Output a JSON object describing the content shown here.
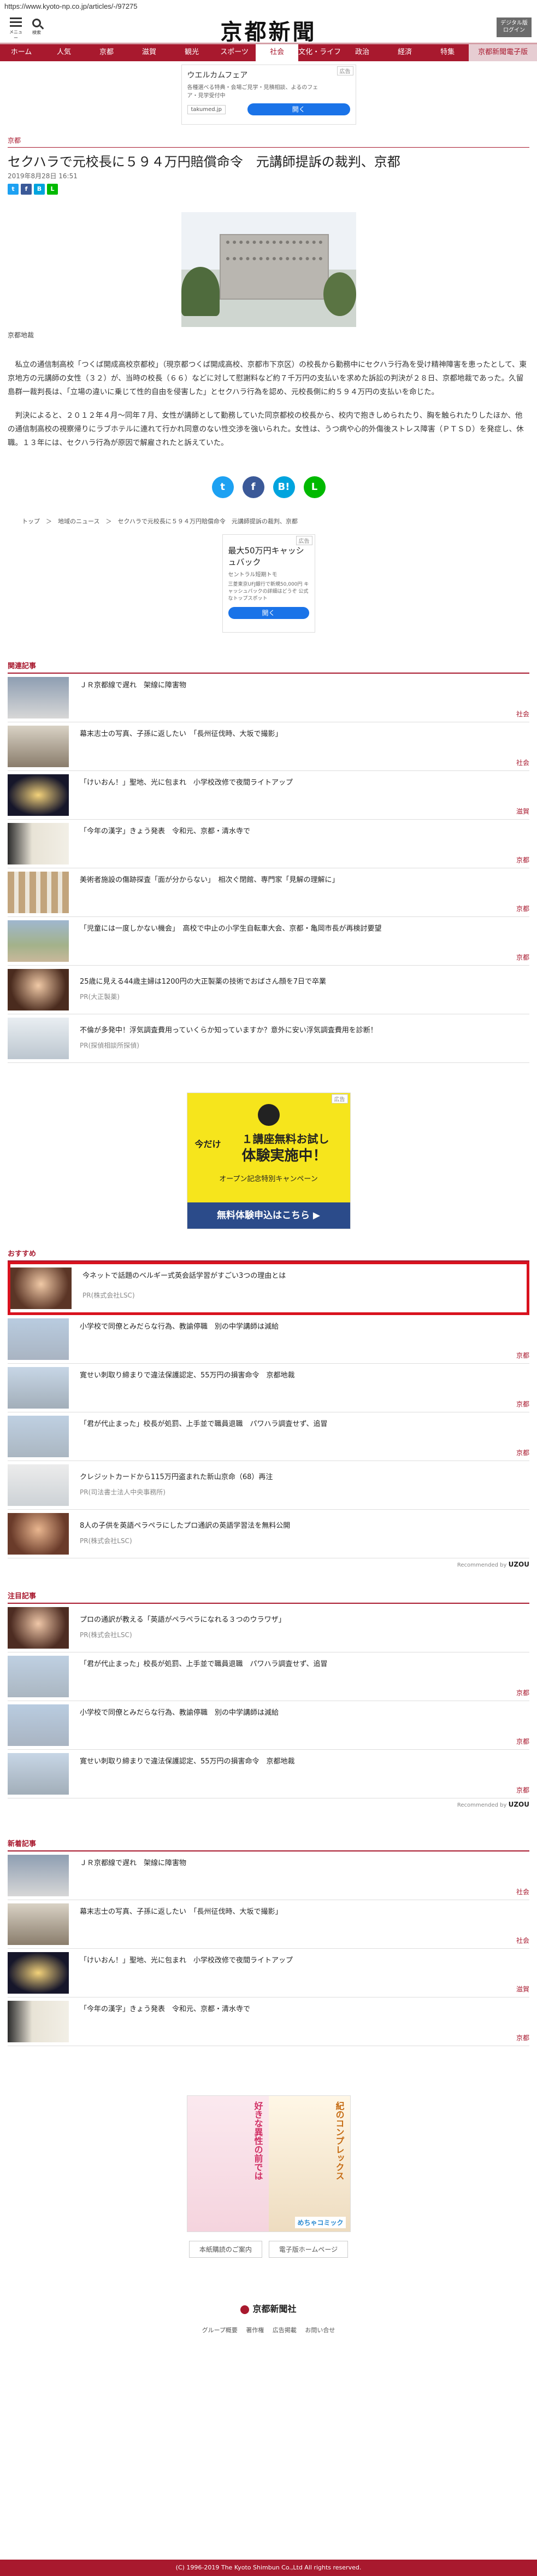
{
  "url": "https://www.kyoto-np.co.jp/articles/-/97275",
  "header": {
    "menu_label": "メニュー",
    "search_label": "検索",
    "logo": "京都新聞",
    "digital_line1": "デジタル版",
    "digital_line2": "ログイン"
  },
  "nav": [
    "ホーム",
    "人気",
    "京都",
    "滋賀",
    "観光",
    "スポーツ",
    "社会",
    "文化・ライフ",
    "政治",
    "経済",
    "特集",
    "京都新聞電子版"
  ],
  "top_ad": {
    "tag": "広告",
    "title": "ウエルカムフェア",
    "text": "各種選べる特典・会場ご見学・見積相談、よるのフェア・見学受付中",
    "domain": "takumed.jp",
    "button": "開く"
  },
  "article": {
    "section": "京都",
    "headline": "セクハラで元校長に５９４万円賠償命令　元講師提訴の裁判、京都",
    "date": "2019年8月28日 16:51",
    "caption": "京都地裁",
    "paragraphs": [
      "私立の通信制高校「つくば開成高校京都校」（現京都つくば開成高校、京都市下京区）の校長から勤務中にセクハラ行為を受け精神障害を患ったとして、東京地方の元講師の女性（３２）が、当時の校長（６６）などに対して慰謝料など約７千万円の支払いを求めた訴訟の判決が２８日、京都地裁であった。久留島群一裁判長は、「立場の違いに乗じて性的自由を侵害した」とセクハラ行為を認め、元校長側に約５９４万円の支払いを命じた。",
      "判決によると、２０１２年４月〜同年７月、女性が講師として勤務していた同京都校の校長から、校内で抱きしめられたり、胸を触られたりしたほか、他の通信制高校の視察帰りにラブホテルに連れて行かれ同意のない性交渉を強いられた。女性は、うつ病や心的外傷後ストレス障害（ＰＴＳＤ）を発症し、休職。１３年には、セクハラ行為が原因で解雇されたと訴えていた。"
    ]
  },
  "breadcrumb": "トップ　＞　地域のニュース　＞　セクハラで元校長に５９４万円賠償命令　元講師提訴の裁判、京都",
  "mid_ad": {
    "tag": "広告",
    "title": "最大50万円キャッシュバック",
    "sub": "セントラル短期トモ",
    "text": "三菱東京UFJ銀行で新規50,000円 キャッシュバックの詳細はどうぞ 公式なトップスポット",
    "button": "開く"
  },
  "related": {
    "title": "関連記事",
    "items": [
      {
        "title": "ＪＲ京都線で遅れ　架線に障害物",
        "cat": "社会"
      },
      {
        "title": "幕末志士の写真、子孫に返したい　「長州征伐時、大坂で撮影」",
        "cat": "社会"
      },
      {
        "title": "「けいおん！」聖地、光に包まれ　小学校改修で夜間ライトアップ",
        "cat": "滋賀"
      },
      {
        "title": "「今年の漢字」きょう発表　令和元、京都・清水寺で",
        "cat": "京都"
      },
      {
        "title": "美術者施設の傷跡探査「面が分からない」　相次ぐ閉館、専門家「見解の理解に」",
        "cat": "京都"
      },
      {
        "title": "「児童には一度しかない機会」　高校で中止の小学生自転車大会、京都・亀岡市長が再検討要望",
        "cat": "京都"
      }
    ],
    "pr": [
      {
        "title": "25歳に見える44歳主婦は1200円の大正製薬の技術でおばさん顔を7日で卒業",
        "sub": "PR(大正製薬)"
      },
      {
        "title": "不倫が多発中！浮気調査費用っていくらか知っていますか？意外に安い浮気調査費用を診断！",
        "sub": "PR(探偵相談所探偵)"
      }
    ]
  },
  "banner_ad": {
    "tag": "広告",
    "top": "今だけ",
    "main1": "１講座無料お試し",
    "main2": "体験実施中！",
    "campaign": "オープン記念特別キャンペーン",
    "button": "無料体験申込はこちら ▶"
  },
  "recommend": {
    "title": "おすすめ",
    "items": [
      {
        "title": "今ネットで話題のベルギー式英会話学習がすごい3つの理由とは",
        "sub": "PR(株式会社LSC)",
        "cat": ""
      },
      {
        "title": "小学校で同僚とみだらな行為、教諭停職　別の中学講師は減給",
        "sub": "",
        "cat": "京都"
      },
      {
        "title": "寛せい刺取り締まりで違法保護認定、55万円の損害命令　京都地裁",
        "sub": "",
        "cat": "京都"
      },
      {
        "title": "「君が代止まった」校長が処罰、上手並で職員退職　パワハラ調査せず、追冒",
        "sub": "",
        "cat": "京都"
      },
      {
        "title": "クレジットカードから115万円盗まれた新山京命（68）再注",
        "sub": "PR(司法書士法人中央事務所)",
        "cat": ""
      },
      {
        "title": "8人の子供を英語ペラペラにしたプロ通訳の英語学習法を無料公開",
        "sub": "PR(株式会社LSC)",
        "cat": ""
      }
    ],
    "credit": "Recommended by",
    "credit_brand": "UZOU"
  },
  "popular": {
    "title": "注目記事",
    "items": [
      {
        "title": "プロの通訳が教える「英語がペラペラになれる３つのウラワザ」",
        "sub": "PR(株式会社LSC)",
        "cat": ""
      },
      {
        "title": "「君が代止まった」校長が処罰、上手並で職員退職　パワハラ調査せず、追冒",
        "sub": "",
        "cat": "京都"
      },
      {
        "title": "小学校で同僚とみだらな行為、教諭停職　別の中学講師は減給",
        "sub": "",
        "cat": "京都"
      },
      {
        "title": "寛せい刺取り締まりで違法保護認定、55万円の損害命令　京都地裁",
        "sub": "",
        "cat": "京都"
      }
    ],
    "credit": "Recommended by",
    "credit_brand": "UZOU"
  },
  "latest": {
    "title": "新着記事",
    "items": [
      {
        "title": "ＪＲ京都線で遅れ　架線に障害物",
        "cat": "社会"
      },
      {
        "title": "幕末志士の写真、子孫に返したい　「長州征伐時、大坂で撮影」",
        "cat": "社会"
      },
      {
        "title": "「けいおん！」聖地、光に包まれ　小学校改修で夜間ライトアップ",
        "cat": "滋賀"
      },
      {
        "title": "「今年の漢字」きょう発表　令和元、京都・清水寺で",
        "cat": "京都"
      }
    ]
  },
  "comic_ad": {
    "left": "好きな異性の前では",
    "right": "紀のコンプレックス",
    "brand": "めちゃコミック"
  },
  "footer": {
    "links": [
      "本紙購読のご案内",
      "電子版ホームページ"
    ],
    "logo": "京都新聞社",
    "nav": [
      "グループ概要",
      "著作権",
      "広告掲載",
      "お問い合せ"
    ],
    "copyright": "(C) 1996-2019 The Kyoto Shimbun Co.,Ltd All rights reserved."
  }
}
